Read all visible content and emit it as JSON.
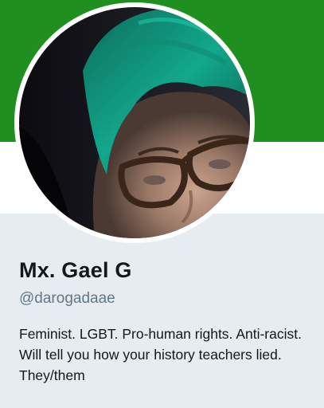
{
  "profile": {
    "display_name": "Mx. Gael G",
    "handle": "@darogadaae",
    "bio": "Feminist. LGBT. Pro-human rights. Anti-racist. Will tell you how your history teachers lied. They/them"
  },
  "colors": {
    "header_banner": "#1f8f1f",
    "page_background": "#e6ecf0",
    "name_text": "#14171a",
    "handle_text": "#657786"
  },
  "icons": {
    "avatar": "profile-photo"
  }
}
